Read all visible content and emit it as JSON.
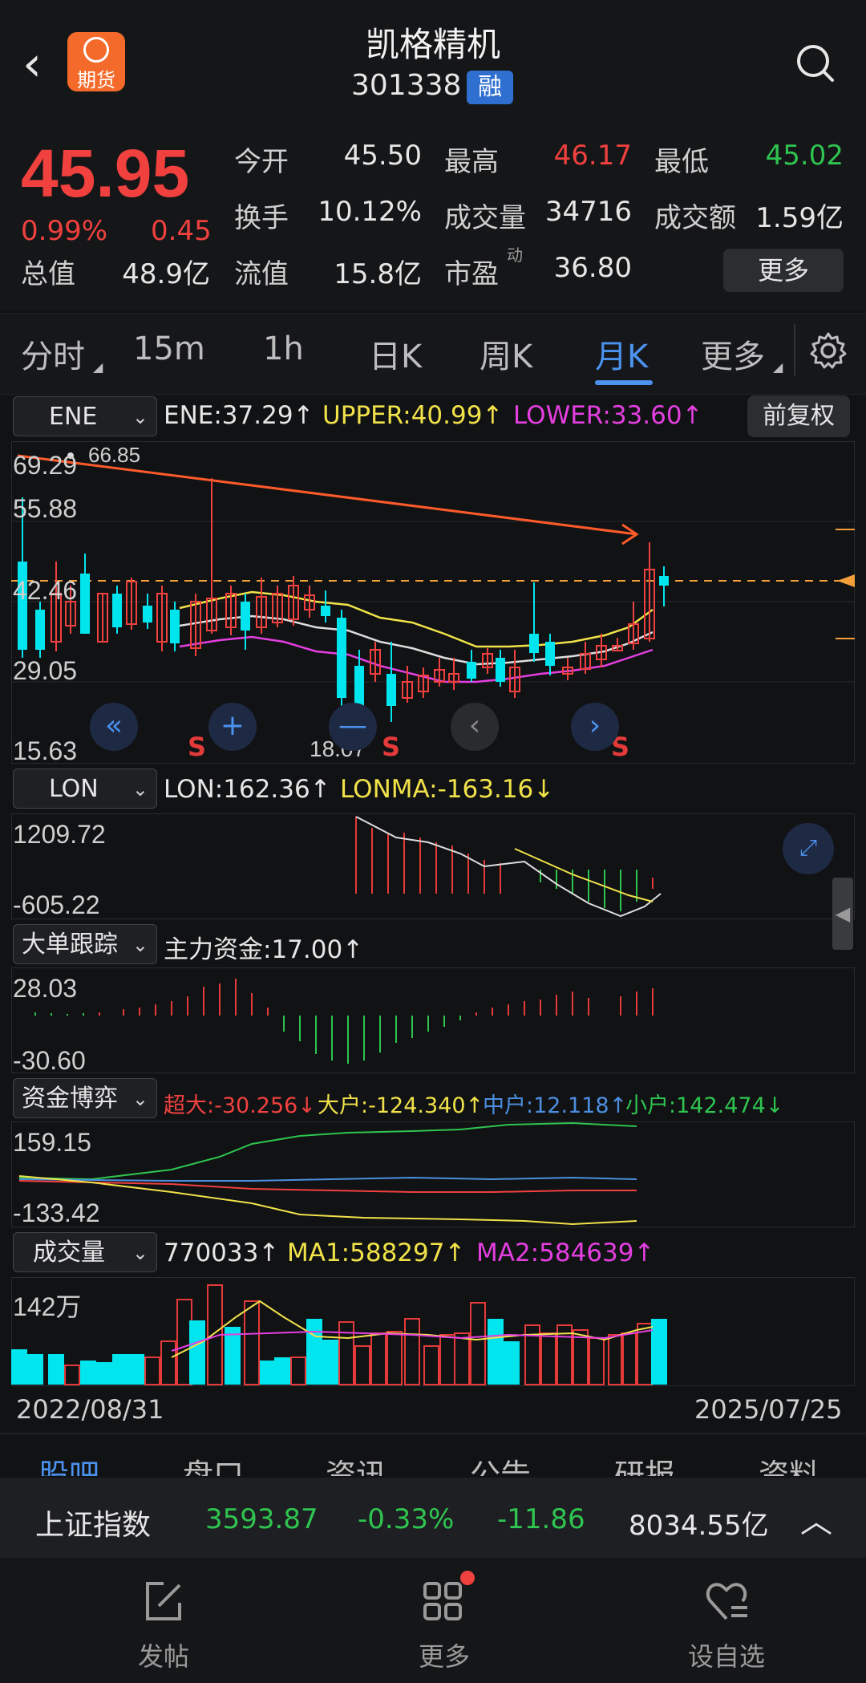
{
  "header": {
    "title": "凯格精机",
    "code": "301338",
    "rong": "融",
    "badge": "期货"
  },
  "quote": {
    "price": "45.95",
    "pct": "0.99%",
    "chg": "0.45",
    "total_label": "总值",
    "total_value": "48.9亿",
    "open_label": "今开",
    "open": "45.50",
    "high_label": "最高",
    "high": "46.17",
    "low_label": "最低",
    "low": "45.02",
    "turn_label": "换手",
    "turn": "10.12%",
    "vol_label": "成交量",
    "vol": "34716",
    "amt_label": "成交额",
    "amt": "1.59亿",
    "float_label": "流值",
    "float_value": "15.8亿",
    "pe_label": "市盈",
    "pe_sup": "动",
    "pe": "36.80",
    "more": "更多"
  },
  "tabs": [
    "分时",
    "15m",
    "1h",
    "日K",
    "周K",
    "月K",
    "更多"
  ],
  "active_tab": "月K",
  "ene": {
    "selector": "ENE",
    "ene": "ENE:37.29↑",
    "upper": "UPPER:40.99↑",
    "lower": "LOWER:33.60↑",
    "adjust": "前复权",
    "axis": [
      "69.29",
      "55.88",
      "42.46",
      "29.05",
      "15.63"
    ],
    "high_mark": "66.85",
    "low_mark": "18.07",
    "s": "S"
  },
  "lon": {
    "selector": "LON",
    "lon": "LON:162.36↑",
    "lonma": "LONMA:-163.16↓",
    "axis": [
      "1209.72",
      "-605.22"
    ]
  },
  "big": {
    "selector": "大单跟踪",
    "main": "主力资金:17.00↑",
    "axis": [
      "28.03",
      "-30.60"
    ]
  },
  "game": {
    "selector": "资金博弈",
    "super": "超大:-30.256↓",
    "large": "大户:-124.340↑",
    "mid": "中户:12.118↑",
    "small": "小户:142.474↓",
    "axis": [
      "159.15",
      "-133.42"
    ]
  },
  "volume": {
    "selector": "成交量",
    "vol": "770033↑",
    "ma1": "MA1:588297↑",
    "ma2": "MA2:584639↑",
    "axis": [
      "142万"
    ]
  },
  "dates": {
    "start": "2022/08/31",
    "end": "2025/07/25"
  },
  "subtabs": [
    "股吧",
    "盘口",
    "资讯",
    "公告",
    "研报",
    "资料"
  ],
  "index": {
    "name": "上证指数",
    "value": "3593.87",
    "pct": "-0.33%",
    "chg": "-11.86",
    "amount": "8034.55亿"
  },
  "nav": [
    "发帖",
    "更多",
    "设自选"
  ],
  "colors": {
    "up": "#f0413f",
    "down": "#00e5ee",
    "accent": "#4b93ef"
  }
}
